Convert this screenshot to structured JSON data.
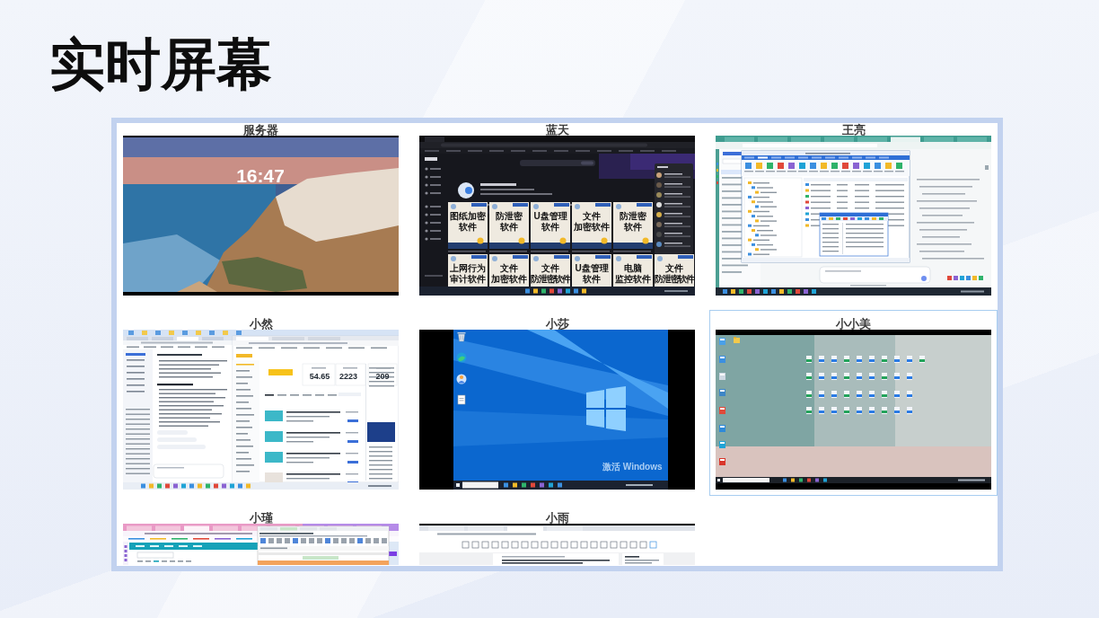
{
  "page": {
    "title": "实时屏幕"
  },
  "screens": [
    {
      "name": "服务器",
      "selected": false,
      "kind": "lock_screen",
      "clock": "16:47"
    },
    {
      "name": "蓝天",
      "selected": false,
      "kind": "video_site",
      "tile_rows": [
        [
          {
            "lines": [
              "图纸加密",
              "软件"
            ]
          },
          {
            "lines": [
              "防泄密",
              "软件"
            ]
          },
          {
            "lines": [
              "U盘管理",
              "软件"
            ]
          },
          {
            "lines": [
              "文件",
              "加密软件"
            ]
          },
          {
            "lines": [
              "防泄密",
              "软件"
            ]
          }
        ],
        [
          {
            "lines": [
              "上网行为",
              "审计软件"
            ]
          },
          {
            "lines": [
              "文件",
              "加密软件"
            ]
          },
          {
            "lines": [
              "文件",
              "防泄密软件"
            ]
          },
          {
            "lines": [
              "U盘管理",
              "软件"
            ]
          },
          {
            "lines": [
              "电脑",
              "监控软件"
            ]
          },
          {
            "lines": [
              "文件",
              "防泄密软件"
            ]
          }
        ]
      ]
    },
    {
      "name": "王亮",
      "selected": false,
      "kind": "file_dialog"
    },
    {
      "name": "小然",
      "selected": false,
      "kind": "split_browsers",
      "stats": [
        "54.65",
        "2223",
        "209"
      ]
    },
    {
      "name": "小莎",
      "selected": false,
      "kind": "win_desktop",
      "watermark": "激活 Windows"
    },
    {
      "name": "小小美",
      "selected": true,
      "kind": "photo_desktop"
    },
    {
      "name": "小瑾",
      "selected": false,
      "kind": "web_editor"
    },
    {
      "name": "小雨",
      "selected": false,
      "kind": "doc_editor"
    }
  ]
}
